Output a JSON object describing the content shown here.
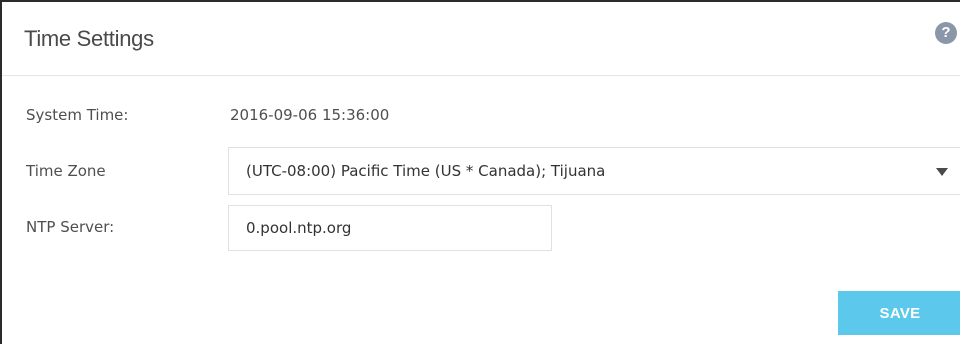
{
  "header": {
    "title": "Time Settings",
    "help_icon": "question-mark-icon",
    "help_glyph": "?"
  },
  "form": {
    "system_time": {
      "label": "System Time:",
      "value": "2016-09-06 15:36:00"
    },
    "time_zone": {
      "label": "Time Zone",
      "selected": "(UTC-08:00) Pacific Time (US * Canada); Tijuana",
      "icon": "caret-down-icon"
    },
    "ntp_server": {
      "label": "NTP Server:",
      "value": "0.pool.ntp.org"
    }
  },
  "actions": {
    "save_label": "SAVE",
    "save_color": "#5cc8ec"
  }
}
